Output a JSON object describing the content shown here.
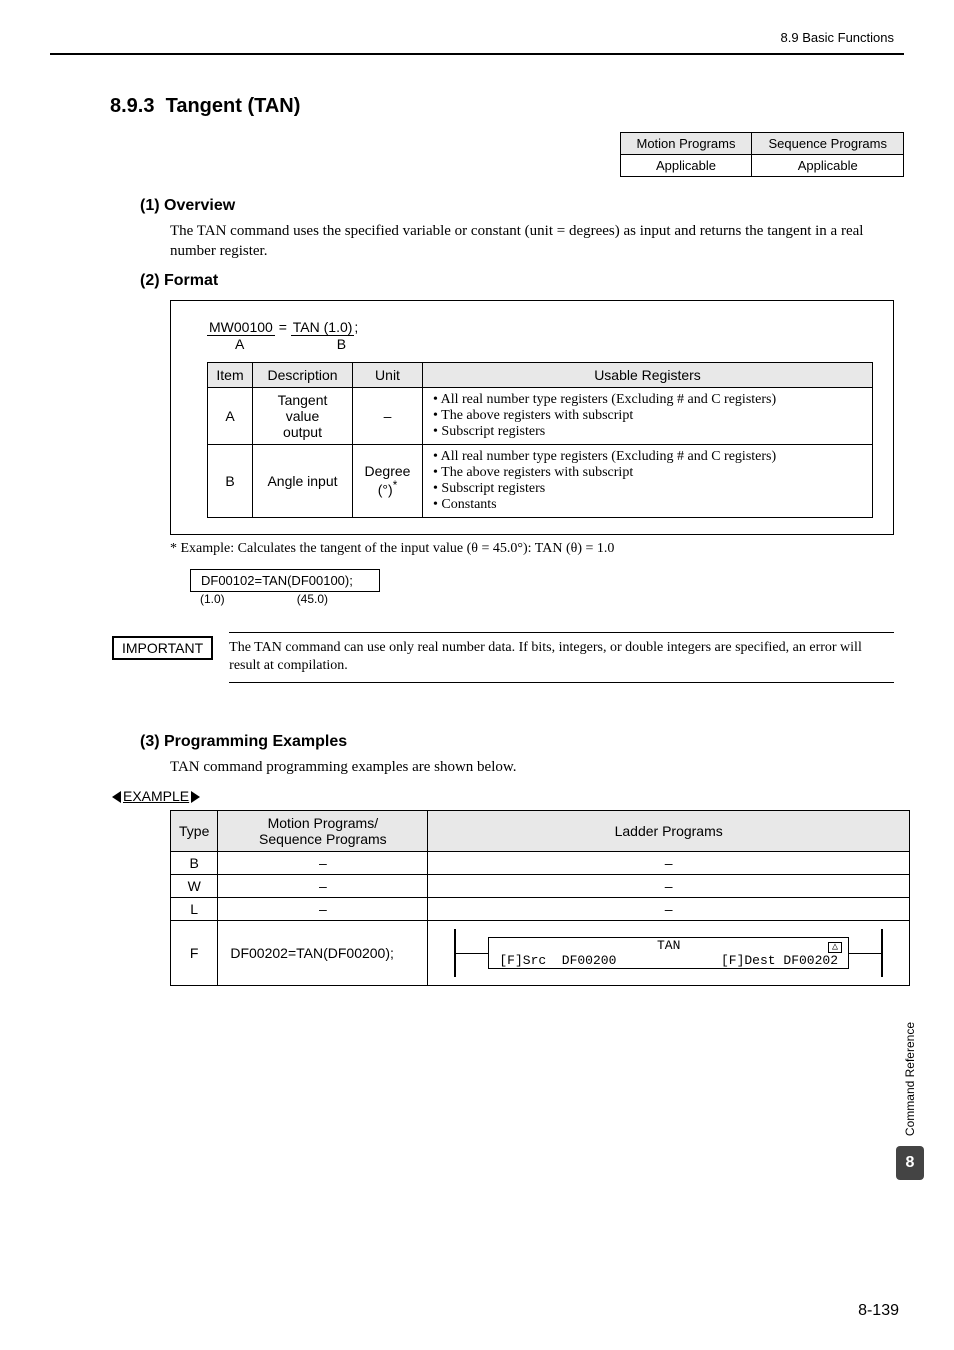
{
  "header": {
    "breadcrumb": "8.9  Basic Functions"
  },
  "section": {
    "number": "8.9.3",
    "title": "Tangent (TAN)"
  },
  "app_table": {
    "h1": "Motion Programs",
    "h2": "Sequence Programs",
    "v1": "Applicable",
    "v2": "Applicable"
  },
  "overview": {
    "heading": "(1) Overview",
    "text": "The TAN command uses the specified variable or constant (unit = degrees) as input and returns the tangent in a real number register."
  },
  "format": {
    "heading": "(2) Format",
    "code": "MW00100 = TAN (1.0);",
    "label_a": "A",
    "label_b": "B",
    "th_item": "Item",
    "th_desc": "Description",
    "th_unit": "Unit",
    "th_reg": "Usable Registers",
    "row_a": {
      "item": "A",
      "desc": "Tangent value output",
      "unit": "–",
      "reg": "• All real number type registers (Excluding # and C registers)\n• The above registers with subscript\n• Subscript registers"
    },
    "row_b": {
      "item": "B",
      "desc": "Angle input",
      "unit": "Degree (°)*",
      "reg": "• All real number type registers (Excluding # and C registers)\n• The above registers with subscript\n• Subscript registers\n• Constants"
    },
    "footnote": "*  Example: Calculates the tangent of the input value (θ = 45.0°): TAN (θ) = 1.0",
    "example_code": "DF00102=TAN(DF00100);",
    "example_vals_a": "(1.0)",
    "example_vals_b": "(45.0)"
  },
  "important": {
    "label": "IMPORTANT",
    "text": "The TAN command can use only real number data. If bits, integers, or double integers are specified, an error will result at compilation."
  },
  "prog": {
    "heading": "(3) Programming Examples",
    "intro": "TAN command programming examples are shown below.",
    "example_label": "EXAMPLE",
    "th_type": "Type",
    "th_motion": "Motion Programs/\nSequence Programs",
    "th_ladder": "Ladder Programs",
    "rows": {
      "b": {
        "type": "B",
        "m": "–",
        "l": "–"
      },
      "w": {
        "type": "W",
        "m": "–",
        "l": "–"
      },
      "l": {
        "type": "L",
        "m": "–",
        "l": "–"
      },
      "f": {
        "type": "F",
        "m": "DF00202=TAN(DF00200);"
      }
    },
    "ladder": {
      "name": "TAN",
      "src_lbl": "[F]Src",
      "src_val": "DF00200",
      "dest_lbl": "[F]Dest",
      "dest_val": "DF00202"
    }
  },
  "side": {
    "text": "Command Reference",
    "chapter": "8"
  },
  "page": "8-139"
}
